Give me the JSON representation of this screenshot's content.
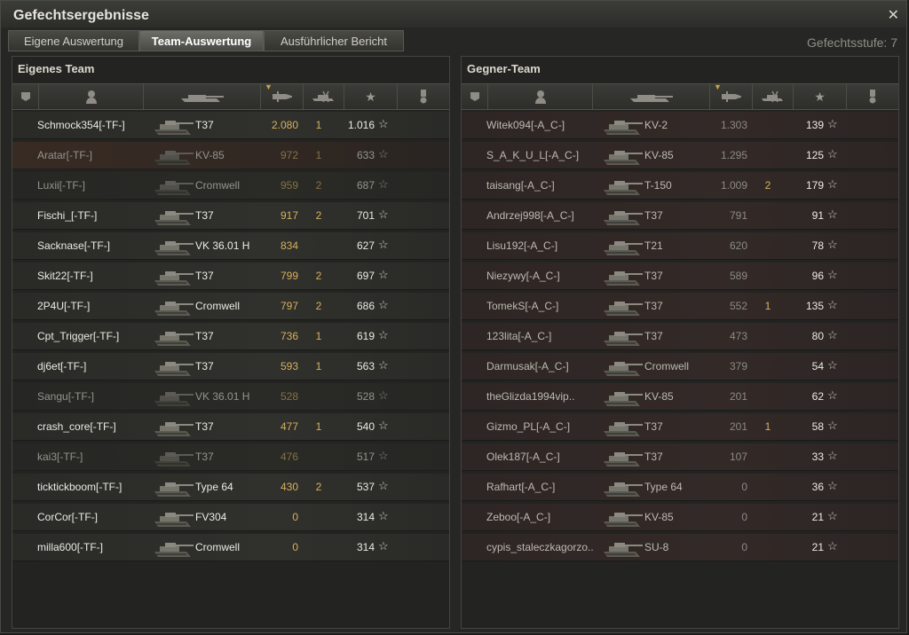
{
  "window": {
    "title": "Gefechtsergebnisse",
    "close_icon": "close-icon",
    "battle_tier": "Gefechtsstufe: 7"
  },
  "tabs": [
    {
      "label": "Eigene Auswertung",
      "active": false
    },
    {
      "label": "Team-Auswertung",
      "active": true
    },
    {
      "label": "Ausführlicher Bericht",
      "active": false
    }
  ],
  "own_team": {
    "title": "Eigenes Team",
    "columns": [
      "squad-icon",
      "player-icon",
      "tank-icon",
      "damage-icon",
      "kills-icon",
      "experience-star-icon",
      "medal-icon"
    ],
    "rows": [
      {
        "player": "Schmock354[-TF-]",
        "tank": "T37",
        "damage": "2.080",
        "kills": "1",
        "xp": "1.016",
        "state": "alive"
      },
      {
        "player": "Aratar[-TF-]",
        "tank": "KV-85",
        "damage": "972",
        "kills": "1",
        "xp": "633",
        "state": "highlight"
      },
      {
        "player": "Luxii[-TF-]",
        "tank": "Cromwell",
        "damage": "959",
        "kills": "2",
        "xp": "687",
        "state": "dead"
      },
      {
        "player": "Fischi_[-TF-]",
        "tank": "T37",
        "damage": "917",
        "kills": "2",
        "xp": "701",
        "state": "alive"
      },
      {
        "player": "Sacknase[-TF-]",
        "tank": "VK 36.01 H",
        "damage": "834",
        "kills": "",
        "xp": "627",
        "state": "alive"
      },
      {
        "player": "Skit22[-TF-]",
        "tank": "T37",
        "damage": "799",
        "kills": "2",
        "xp": "697",
        "state": "alive"
      },
      {
        "player": "2P4U[-TF-]",
        "tank": "Cromwell",
        "damage": "797",
        "kills": "2",
        "xp": "686",
        "state": "alive"
      },
      {
        "player": "Cpt_Trigger[-TF-]",
        "tank": "T37",
        "damage": "736",
        "kills": "1",
        "xp": "619",
        "state": "alive"
      },
      {
        "player": "dj6et[-TF-]",
        "tank": "T37",
        "damage": "593",
        "kills": "1",
        "xp": "563",
        "state": "alive"
      },
      {
        "player": "Sangu[-TF-]",
        "tank": "VK 36.01 H",
        "damage": "528",
        "kills": "",
        "xp": "528",
        "state": "dead"
      },
      {
        "player": "crash_core[-TF-]",
        "tank": "T37",
        "damage": "477",
        "kills": "1",
        "xp": "540",
        "state": "alive"
      },
      {
        "player": "kai3[-TF-]",
        "tank": "T37",
        "damage": "476",
        "kills": "",
        "xp": "517",
        "state": "dead"
      },
      {
        "player": "ticktickboom[-TF-]",
        "tank": "Type 64",
        "damage": "430",
        "kills": "2",
        "xp": "537",
        "state": "alive"
      },
      {
        "player": "CorCor[-TF-]",
        "tank": "FV304",
        "damage": "0",
        "kills": "",
        "xp": "314",
        "state": "alive"
      },
      {
        "player": "milla600[-TF-]",
        "tank": "Cromwell",
        "damage": "0",
        "kills": "",
        "xp": "314",
        "state": "alive"
      }
    ]
  },
  "enemy_team": {
    "title": "Gegner-Team",
    "columns": [
      "squad-icon",
      "player-icon",
      "tank-icon",
      "damage-icon",
      "kills-icon",
      "experience-star-icon",
      "medal-icon"
    ],
    "rows": [
      {
        "player": "Witek094[-A_C-]",
        "tank": "KV-2",
        "damage": "1.303",
        "kills": "",
        "xp": "139"
      },
      {
        "player": "S_A_K_U_L[-A_C-]",
        "tank": "KV-85",
        "damage": "1.295",
        "kills": "",
        "xp": "125"
      },
      {
        "player": "taisang[-A_C-]",
        "tank": "T-150",
        "damage": "1.009",
        "kills": "2",
        "xp": "179"
      },
      {
        "player": "Andrzej998[-A_C-]",
        "tank": "T37",
        "damage": "791",
        "kills": "",
        "xp": "91"
      },
      {
        "player": "Lisu192[-A_C-]",
        "tank": "T21",
        "damage": "620",
        "kills": "",
        "xp": "78"
      },
      {
        "player": "Niezywy[-A_C-]",
        "tank": "T37",
        "damage": "589",
        "kills": "",
        "xp": "96"
      },
      {
        "player": "TomekS[-A_C-]",
        "tank": "T37",
        "damage": "552",
        "kills": "1",
        "xp": "135"
      },
      {
        "player": "123lita[-A_C-]",
        "tank": "T37",
        "damage": "473",
        "kills": "",
        "xp": "80"
      },
      {
        "player": "Darmusak[-A_C-]",
        "tank": "Cromwell",
        "damage": "379",
        "kills": "",
        "xp": "54"
      },
      {
        "player": "theGlizda1994vip..",
        "tank": "KV-85",
        "damage": "201",
        "kills": "",
        "xp": "62"
      },
      {
        "player": "Gizmo_PL[-A_C-]",
        "tank": "T37",
        "damage": "201",
        "kills": "1",
        "xp": "58"
      },
      {
        "player": "Olek187[-A_C-]",
        "tank": "T37",
        "damage": "107",
        "kills": "",
        "xp": "33"
      },
      {
        "player": "Rafhart[-A_C-]",
        "tank": "Type 64",
        "damage": "0",
        "kills": "",
        "xp": "36"
      },
      {
        "player": "Zeboo[-A_C-]",
        "tank": "KV-85",
        "damage": "0",
        "kills": "",
        "xp": "21"
      },
      {
        "player": "cypis_staleczkagorzo..",
        "tank": "SU-8",
        "damage": "0",
        "kills": "",
        "xp": "21"
      }
    ]
  },
  "colors": {
    "accent_gold": "#d7b15d",
    "bg": "#262624",
    "enemy_row": "#332a28"
  }
}
